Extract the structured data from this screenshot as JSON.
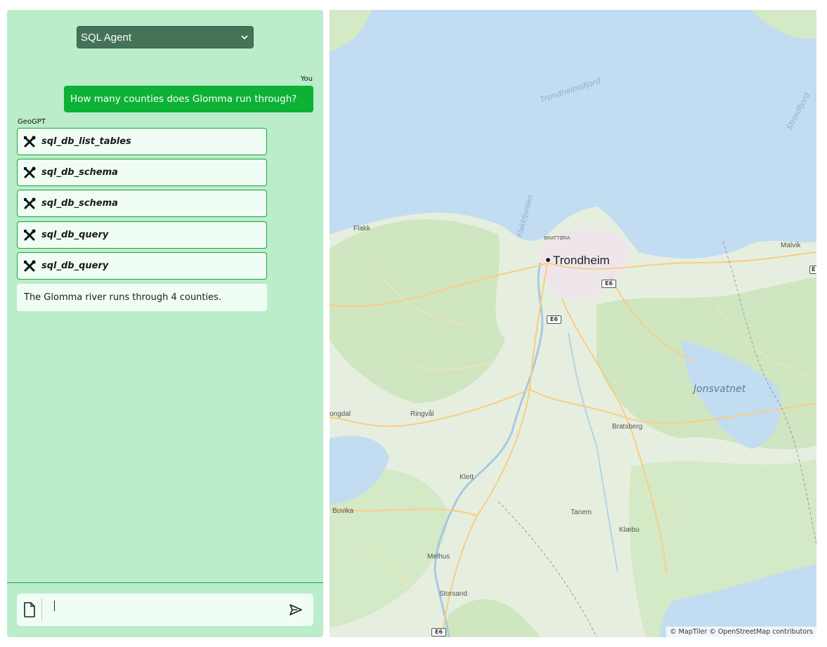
{
  "agent_select": {
    "selected": "SQL Agent"
  },
  "chat": {
    "user_label": "You",
    "bot_label": "GeoGPT",
    "user_message": "How many counties does Glomma run through?",
    "tool_calls": [
      {
        "name": "sql_db_list_tables",
        "icon": "tools-icon"
      },
      {
        "name": "sql_db_schema",
        "icon": "tools-icon"
      },
      {
        "name": "sql_db_schema",
        "icon": "tools-icon"
      },
      {
        "name": "sql_db_query",
        "icon": "tools-icon"
      },
      {
        "name": "sql_db_query",
        "icon": "tools-icon"
      }
    ],
    "answer": "The Glomma river runs through 4 counties."
  },
  "composer": {
    "input_value": "",
    "attach_icon": "file-icon",
    "send_icon": "send-icon"
  },
  "map": {
    "city": "Trondheim",
    "places": {
      "flakk": "Flakk",
      "brattora": "BRATTØRA",
      "malvik": "Malvik",
      "ongdal": "ongdal",
      "ringval": "Ringvål",
      "bratsberg": "Bratsberg",
      "klett": "Klett",
      "buvika": "Buvika",
      "tanem": "Tanem",
      "klaebu": "Klæbu",
      "melhus": "Melhus",
      "storsand": "Storsand"
    },
    "water": {
      "trondheimsfjord": "Trondheimsfjord",
      "strindfjord": "Strindfjord",
      "flakkfjorden": "Flakkfjorden",
      "jonsvatnet": "Jonsvatnet"
    },
    "route_shields": {
      "e6_north": "E6",
      "e6_center": "E6",
      "e6_south": "E6",
      "e_edge": "E"
    },
    "attribution": "© MapTiler © OpenStreetMap contributors",
    "colors": {
      "water": "#c2dcf1",
      "land": "#e6efdf",
      "forest": "#cfe6c1",
      "roads": "#f6cf8a",
      "urban": "#efe6ec"
    }
  }
}
